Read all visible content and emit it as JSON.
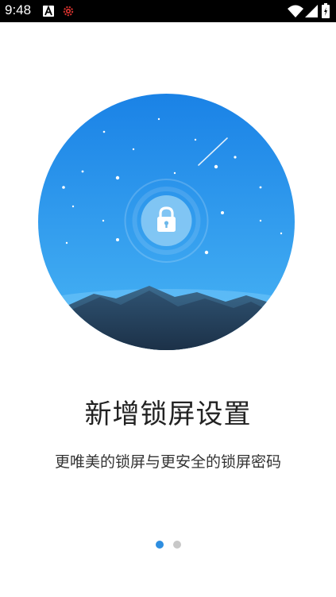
{
  "status_bar": {
    "time": "9:48",
    "icons": [
      "a-notification-icon",
      "gear-icon",
      "wifi-icon",
      "signal-icon",
      "battery-icon"
    ]
  },
  "hero": {
    "illustration": "lock-night-sky-illustration",
    "colors": {
      "sky_top": "#1a82e6",
      "sky_bottom": "#4ab6f5",
      "mountain": "#2e5170"
    }
  },
  "content": {
    "title": "新增锁屏设置",
    "subtitle": "更唯美的锁屏与更安全的锁屏密码"
  },
  "pager": {
    "pages": 2,
    "active_index": 0,
    "active_color": "#2e8ee0",
    "inactive_color": "#c8c8c8"
  }
}
